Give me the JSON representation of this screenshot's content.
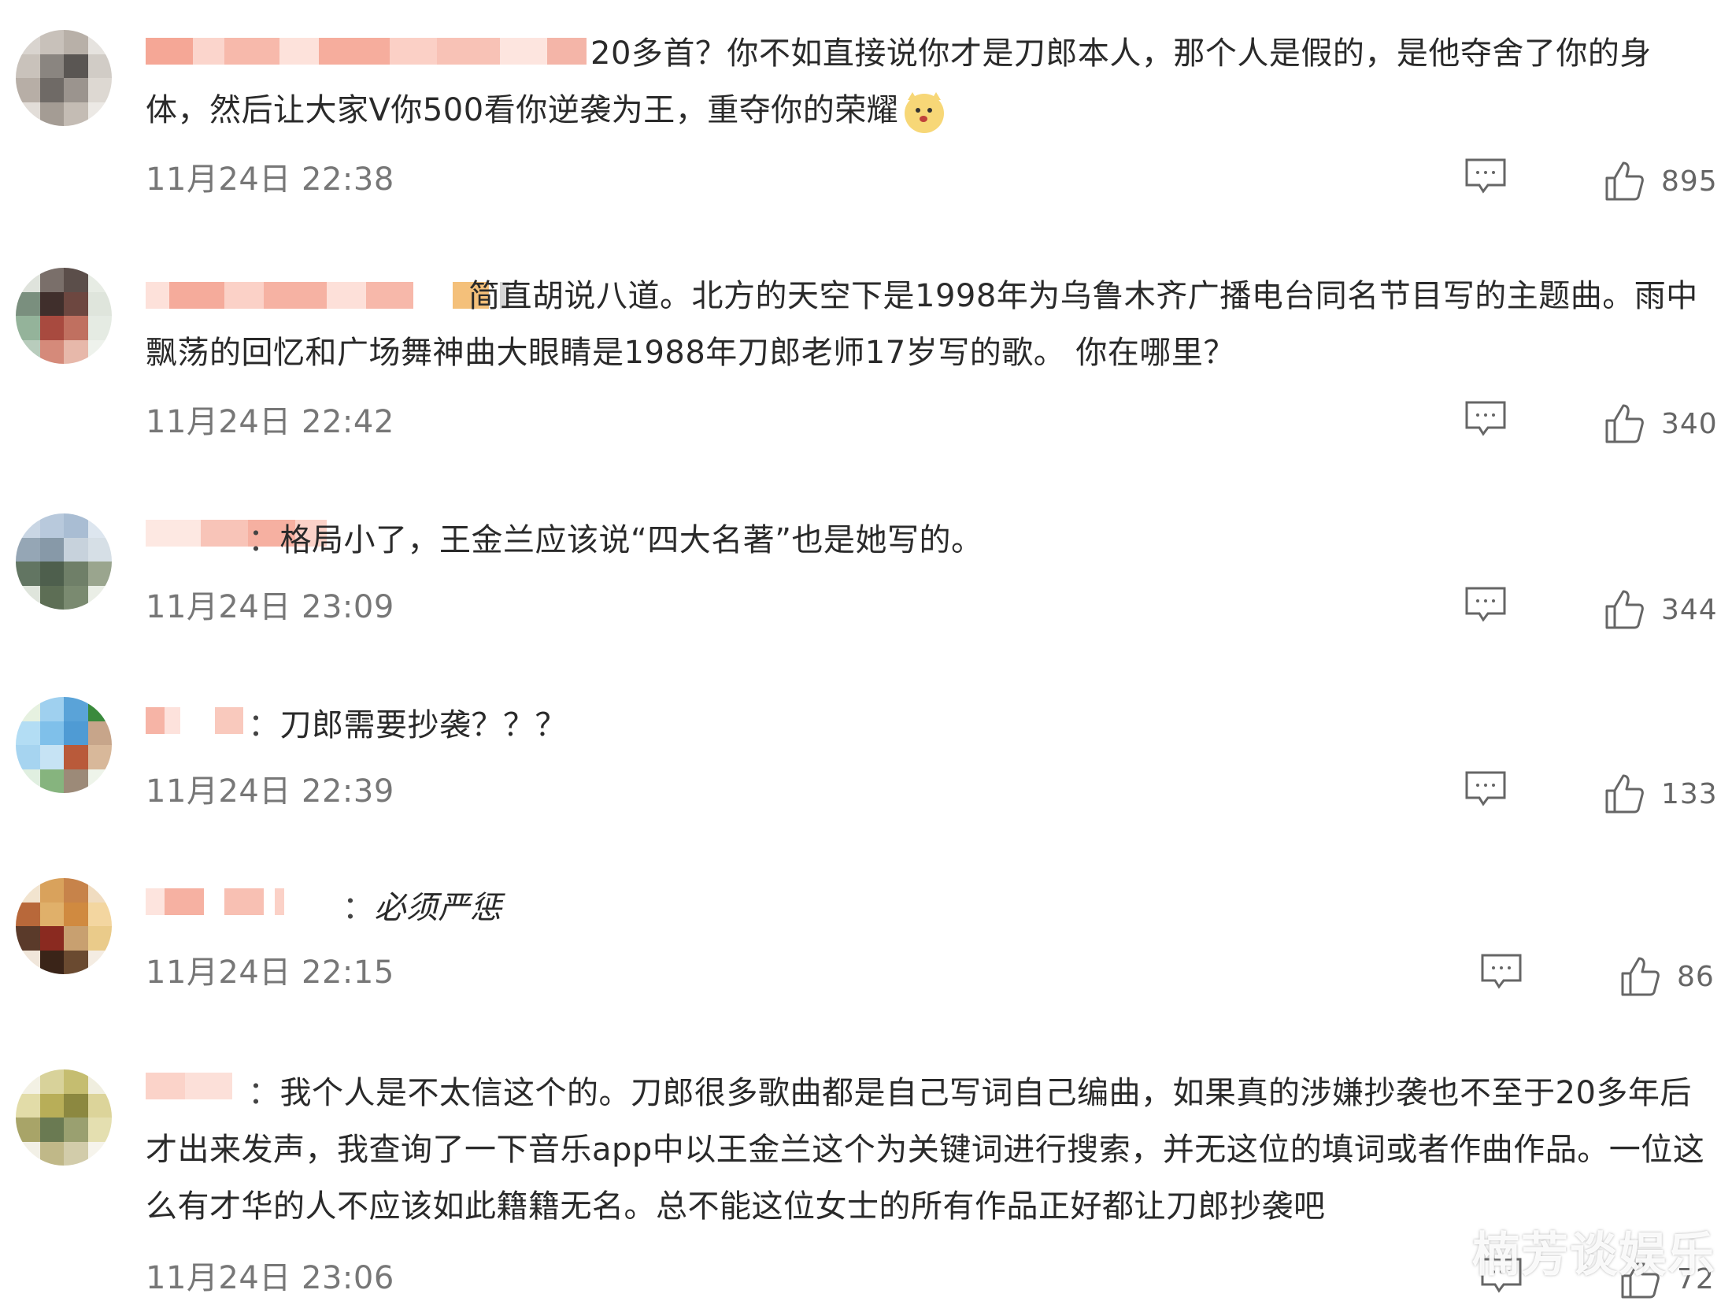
{
  "comments": [
    {
      "text": "20多首？你不如直接说你才是刀郎本人，那个人是假的，是他夺舍了你的身体，然后让大家V你500看你逆袭为王，重夺你的荣耀",
      "time": "11月24日 22:38",
      "likes": "895"
    },
    {
      "text": "简直胡说八道。北方的天空下是1998年为乌鲁木齐广播电台同名节目写的主题曲。雨中飘荡的回忆和广场舞神曲大眼睛是1988年刀郎老师17岁写的歌。 你在哪里？",
      "time": "11月24日 22:42",
      "likes": "340"
    },
    {
      "text": "格局小了，王金兰应该说“四大名著”也是她写的。",
      "time": "11月24日 23:09",
      "likes": "344"
    },
    {
      "text": "刀郎需要抄袭？？？",
      "time": "11月24日 22:39",
      "likes": "133"
    },
    {
      "text": "必须严惩",
      "time": "11月24日 22:15",
      "likes": "86"
    },
    {
      "text": "我个人是不太信这个的。刀郎很多歌曲都是自己写词自己编曲，如果真的涉嫌抄袭也不至于20多年后才出来发声，我查询了一下音乐app中以王金兰这个为关键词进行搜索，并无这位的填词或者作曲作品。一位这么有才华的人不应该如此籍籍无名。总不能这位女士的所有作品正好都让刀郎抄袭吧",
      "time": "11月24日 23:06",
      "likes": "72"
    }
  ],
  "separator": "：",
  "watermark": "楠芳谈娱乐",
  "icons": {
    "reply": "comment-icon",
    "like": "thumbs-up-icon",
    "emoji": "doge-emoji-icon"
  },
  "colors": {
    "blur_pink": "#f6b3a6",
    "time": "#777777",
    "text": "#2a2a2a"
  }
}
